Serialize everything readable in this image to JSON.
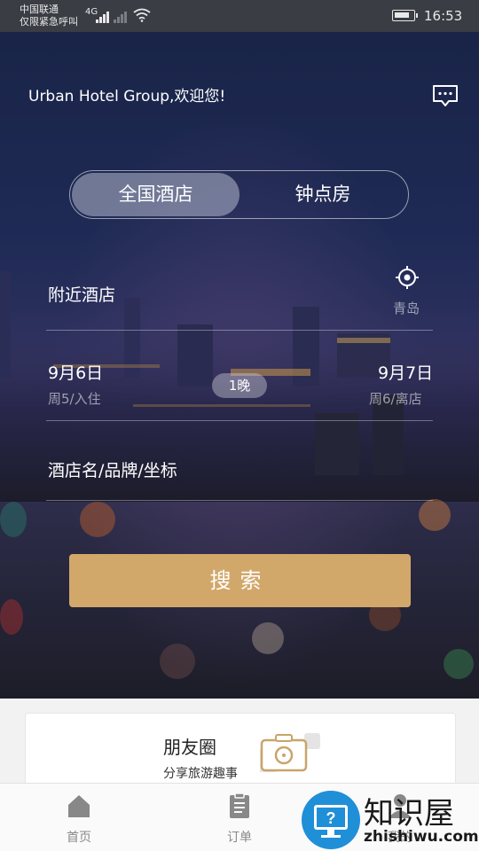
{
  "status_bar": {
    "carrier_line1": "中国联通",
    "carrier_line2": "仅限紧急呼叫",
    "network": "4G",
    "time": "16:53",
    "battery_fraction": 0.85
  },
  "header": {
    "greeting": "Urban Hotel Group,欢迎您!",
    "message_icon": "chat-bubble-icon"
  },
  "tabs": {
    "nationwide": "全国酒店",
    "hourly": "钟点房",
    "active": "nationwide"
  },
  "form": {
    "location_label": "附近酒店",
    "city": "青岛",
    "checkin_date": "9月6日",
    "checkin_sub": "周5/入住",
    "nights": "1晚",
    "checkout_date": "9月7日",
    "checkout_sub": "周6/离店",
    "keyword_placeholder": "酒店名/品牌/坐标",
    "search_label": "搜索"
  },
  "card": {
    "title": "朋友圈",
    "subtitle": "分享旅游趣事",
    "icon": "camera-icon"
  },
  "tabbar": {
    "items": [
      {
        "label": "首页",
        "icon": "home-icon",
        "active": true
      },
      {
        "label": "订单",
        "icon": "clipboard-icon",
        "active": false
      },
      {
        "label": "我的",
        "icon": "user-icon",
        "active": false
      }
    ]
  },
  "watermark": {
    "brand": "知识屋",
    "url": "zhishiwu.com"
  },
  "colors": {
    "accent": "#d2a76a",
    "hero_top": "#1a2448",
    "tab_inactive": "#888888"
  }
}
